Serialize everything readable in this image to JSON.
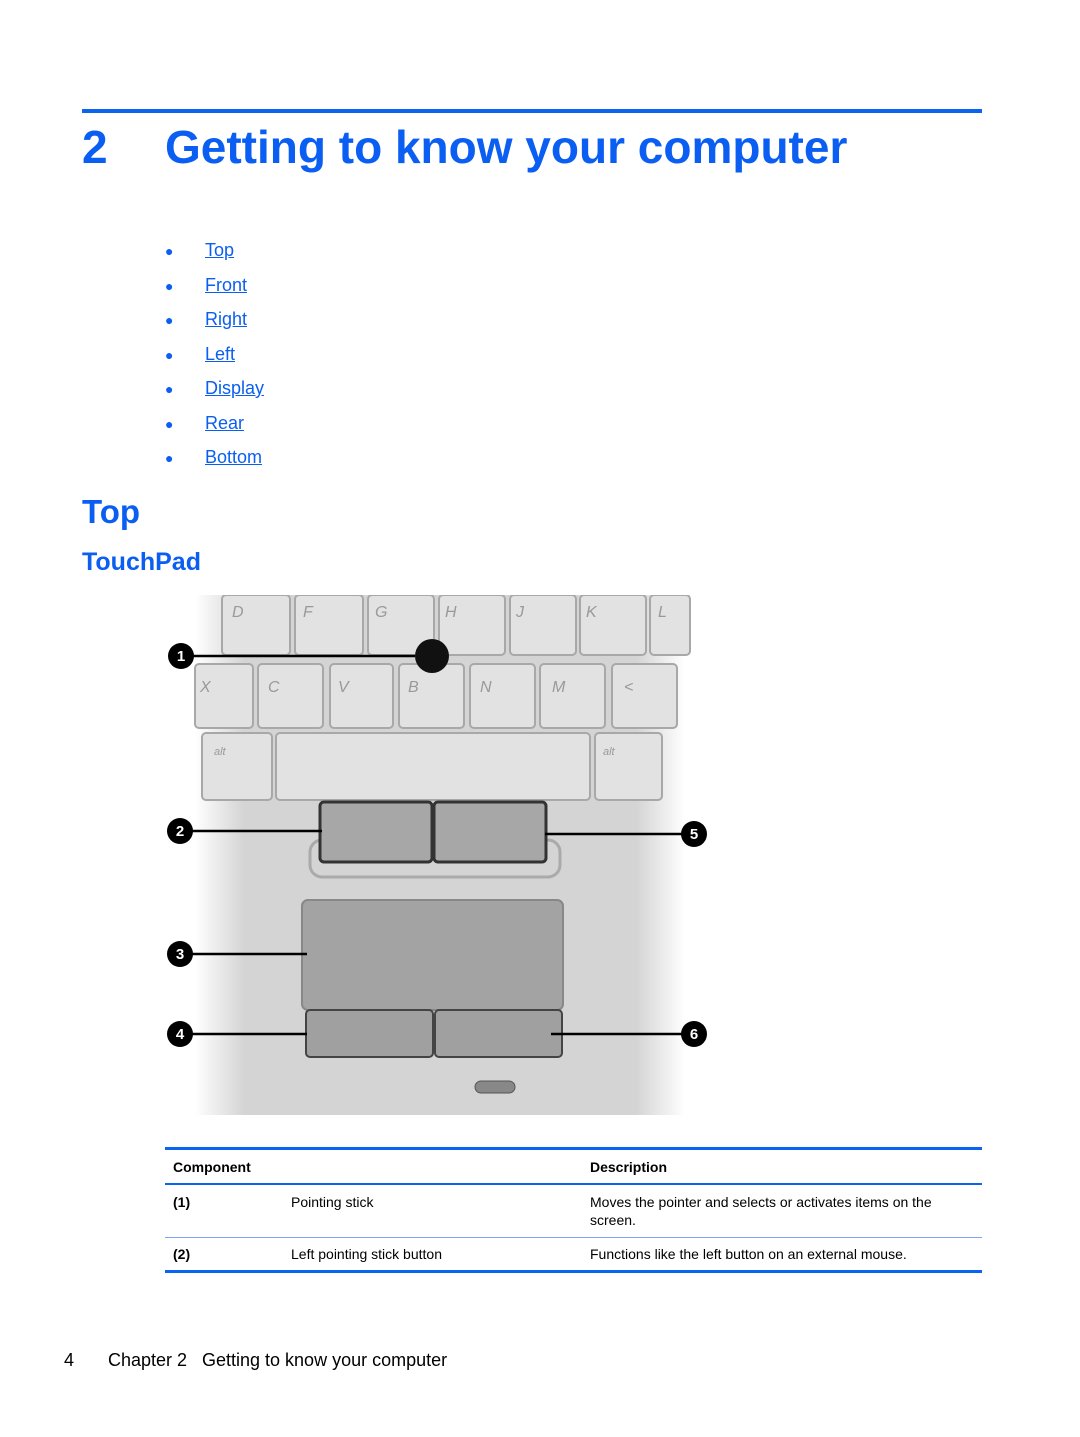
{
  "chapter": {
    "number": "2",
    "title": "Getting to know your computer"
  },
  "toc": [
    {
      "label": "Top"
    },
    {
      "label": "Front"
    },
    {
      "label": "Right"
    },
    {
      "label": "Left"
    },
    {
      "label": "Display"
    },
    {
      "label": "Rear"
    },
    {
      "label": "Bottom"
    }
  ],
  "section": {
    "title": "Top",
    "subtitle": "TouchPad"
  },
  "figure": {
    "callouts": [
      "1",
      "2",
      "3",
      "4",
      "5",
      "6"
    ],
    "keys_row1": [
      "D",
      "F",
      "G",
      "H",
      "J",
      "K",
      "L"
    ],
    "keys_row2": [
      "X",
      "C",
      "V",
      "B",
      "N",
      "M",
      "<"
    ],
    "keys_row3": [
      "alt",
      "alt"
    ]
  },
  "table": {
    "headers": {
      "component": "Component",
      "description": "Description"
    },
    "rows": [
      {
        "num": "(1)",
        "name": "Pointing stick",
        "description": "Moves the pointer and selects or activates items on the screen."
      },
      {
        "num": "(2)",
        "name": "Left pointing stick button",
        "description": "Functions like the left button on an external mouse."
      }
    ]
  },
  "footer": {
    "page": "4",
    "chapter": "Chapter 2",
    "title": "Getting to know your computer"
  },
  "colors": {
    "accent": "#0a5ef2"
  }
}
